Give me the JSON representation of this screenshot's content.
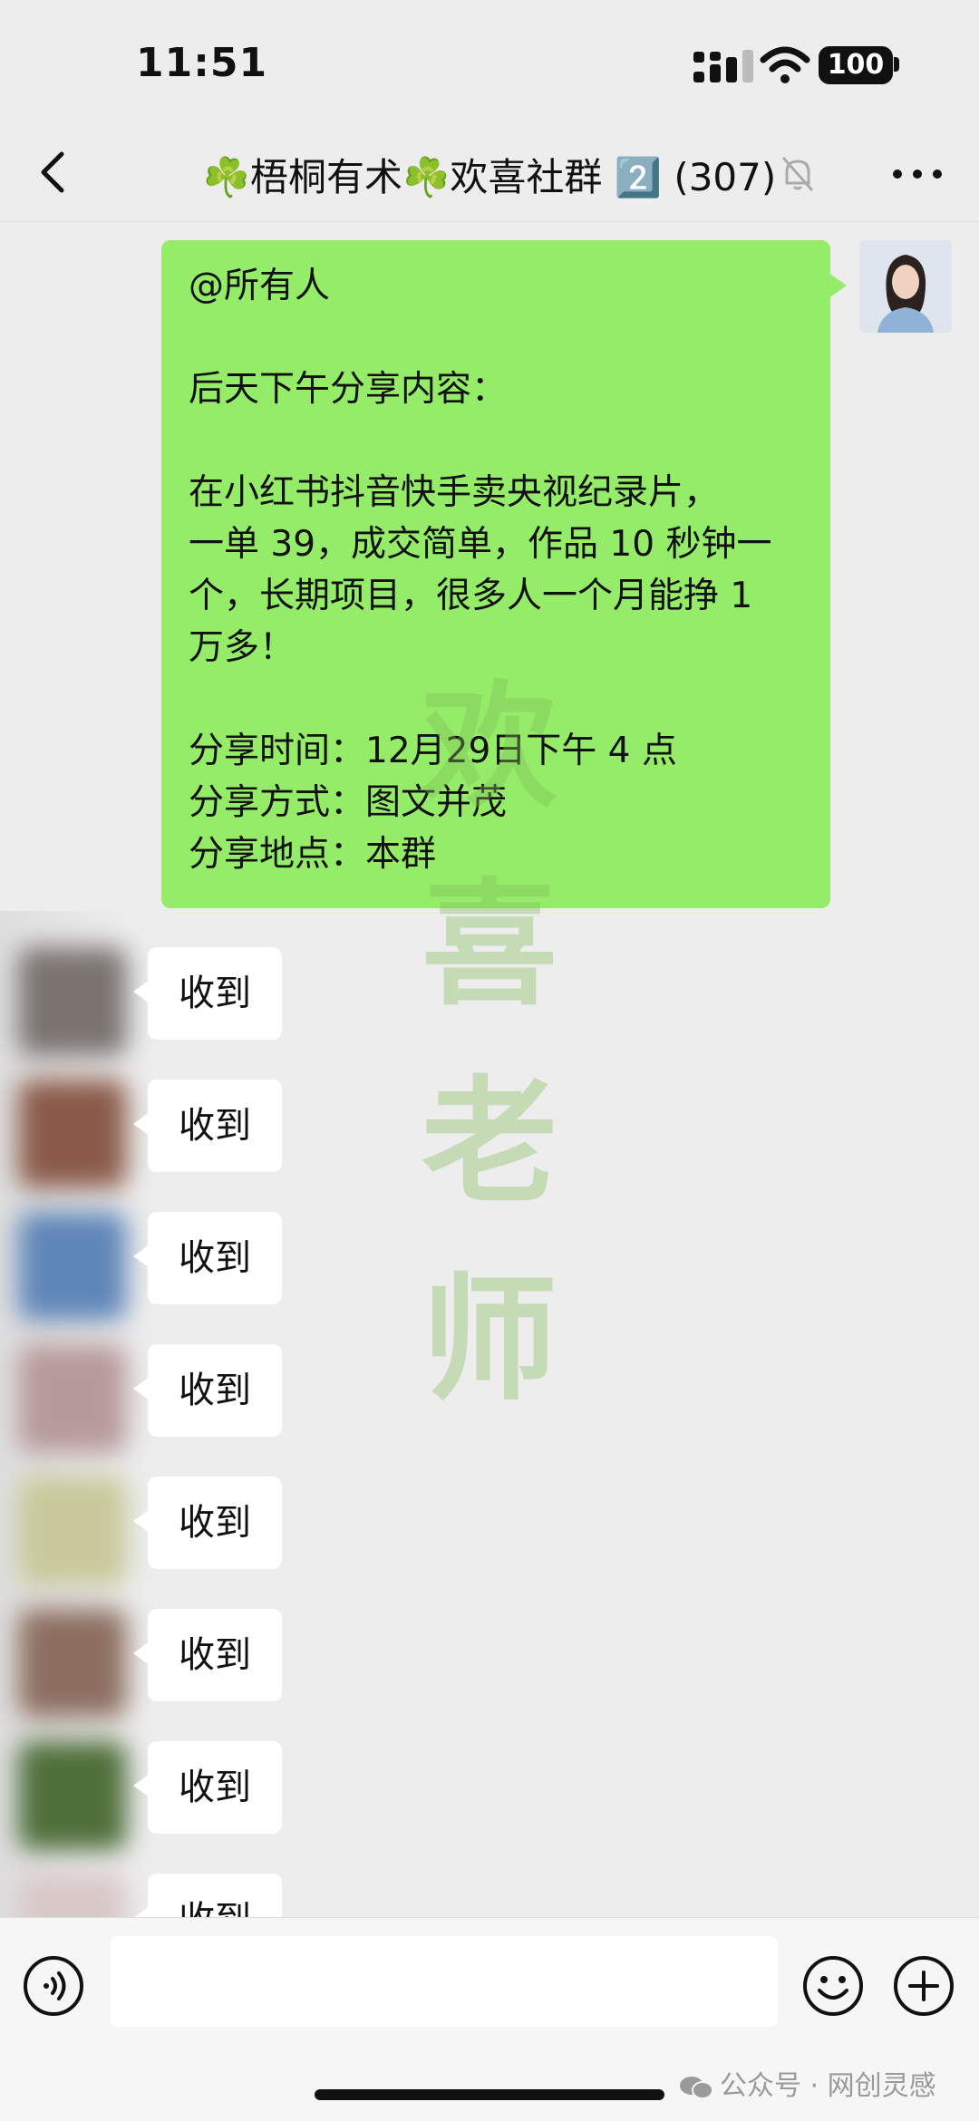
{
  "status_bar": {
    "time": "11:51",
    "battery": "100"
  },
  "header": {
    "title": "☘️梧桐有术☘️欢喜社群 2️⃣ (307)"
  },
  "colors": {
    "self_bubble": "#95ec69",
    "background": "#ededed",
    "other_bubble": "#ffffff",
    "watermark": "#82be5a"
  },
  "message": {
    "lines": [
      "@所有人",
      "",
      "后天下午分享内容：",
      "",
      "在小红书抖音快手卖央视纪录片，",
      "一单 39，成交简单，作品 10 秒钟一",
      "个，长期项目，很多人一个月能挣 1",
      "万多！",
      "",
      "分享时间：12月29日下午 4 点",
      "分享方式：图文并茂",
      "分享地点：本群"
    ]
  },
  "watermark": {
    "chars": [
      "欢",
      "喜",
      "老",
      "师"
    ]
  },
  "replies": [
    {
      "text": "收到",
      "avatar_color": "#7a7370"
    },
    {
      "text": "收到",
      "avatar_color": "#8a5a48"
    },
    {
      "text": "收到",
      "avatar_color": "#5f86b8"
    },
    {
      "text": "收到",
      "avatar_color": "#b79a9a"
    },
    {
      "text": "收到",
      "avatar_color": "#c8c89a"
    },
    {
      "text": "收到",
      "avatar_color": "#8c6e60"
    },
    {
      "text": "收到",
      "avatar_color": "#4e6e3a"
    },
    {
      "text": "收到",
      "avatar_color": "#d9c8c8"
    }
  ],
  "footer": {
    "credit": "公众号 · 网创灵感"
  },
  "icons": [
    "back-icon",
    "mute-bell-icon",
    "more-icon",
    "voice-icon",
    "emoji-icon",
    "plus-icon",
    "wechat-icon"
  ]
}
